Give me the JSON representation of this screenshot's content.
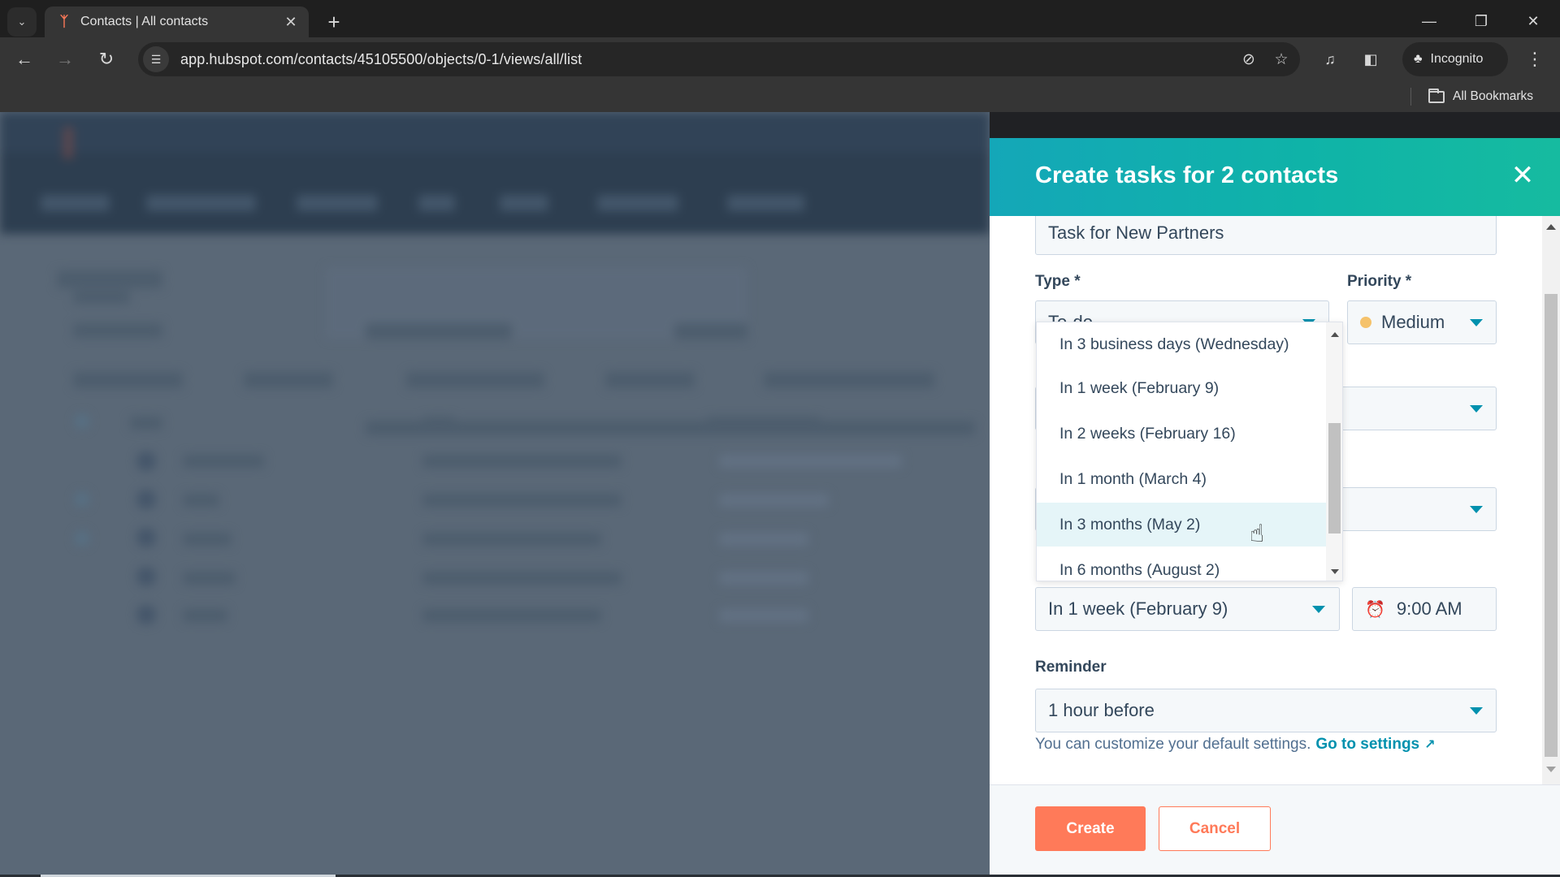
{
  "browser": {
    "tab_title": "Contacts | All contacts",
    "url": "app.hubspot.com/contacts/45105500/objects/0-1/views/all/list",
    "profile_label": "Incognito",
    "bookmarks_label": "All Bookmarks",
    "icons": {
      "tab_search": "chevron-down-icon",
      "favicon": "hubspot-sprocket-icon",
      "tab_close": "close-icon",
      "new_tab": "plus-icon",
      "back": "arrow-left-icon",
      "forward": "arrow-right-icon",
      "reload": "reload-icon",
      "site_info": "tune-icon",
      "eye_off": "eye-off-icon",
      "bookmark_star": "star-icon",
      "media": "media-queue-icon",
      "side_panel": "side-panel-icon",
      "incognito": "incognito-icon",
      "menu": "kebab-menu-icon",
      "folder": "folder-icon",
      "minimize": "minimize-icon",
      "restore": "restore-icon",
      "window_close": "close-icon"
    }
  },
  "panel": {
    "title": "Create tasks for 2 contacts",
    "task_title_value": "Task for New Partners",
    "type_label": "Type *",
    "type_value": "To-do",
    "priority_label": "Priority *",
    "priority_value": "Medium",
    "priority_color": "#f5c26b",
    "due_date_value": "In 1 week (February 9)",
    "due_time_value": "9:00 AM",
    "reminder_label": "Reminder",
    "reminder_value": "1 hour before",
    "hint_text": "You can customize your default settings.",
    "hint_link": "Go to settings",
    "create_label": "Create",
    "cancel_label": "Cancel",
    "colors": {
      "header_start": "#14a7b8",
      "header_end": "#16bba0",
      "accent": "#0091ae",
      "primary_button": "#ff7a59"
    }
  },
  "due_date_dropdown": {
    "options": [
      "In 3 business days (Wednesday)",
      "In 1 week (February 9)",
      "In 2 weeks (February 16)",
      "In 1 month (March 4)",
      "In 3 months (May 2)",
      "In 6 months (August 2)"
    ],
    "hovered_index": 4
  }
}
